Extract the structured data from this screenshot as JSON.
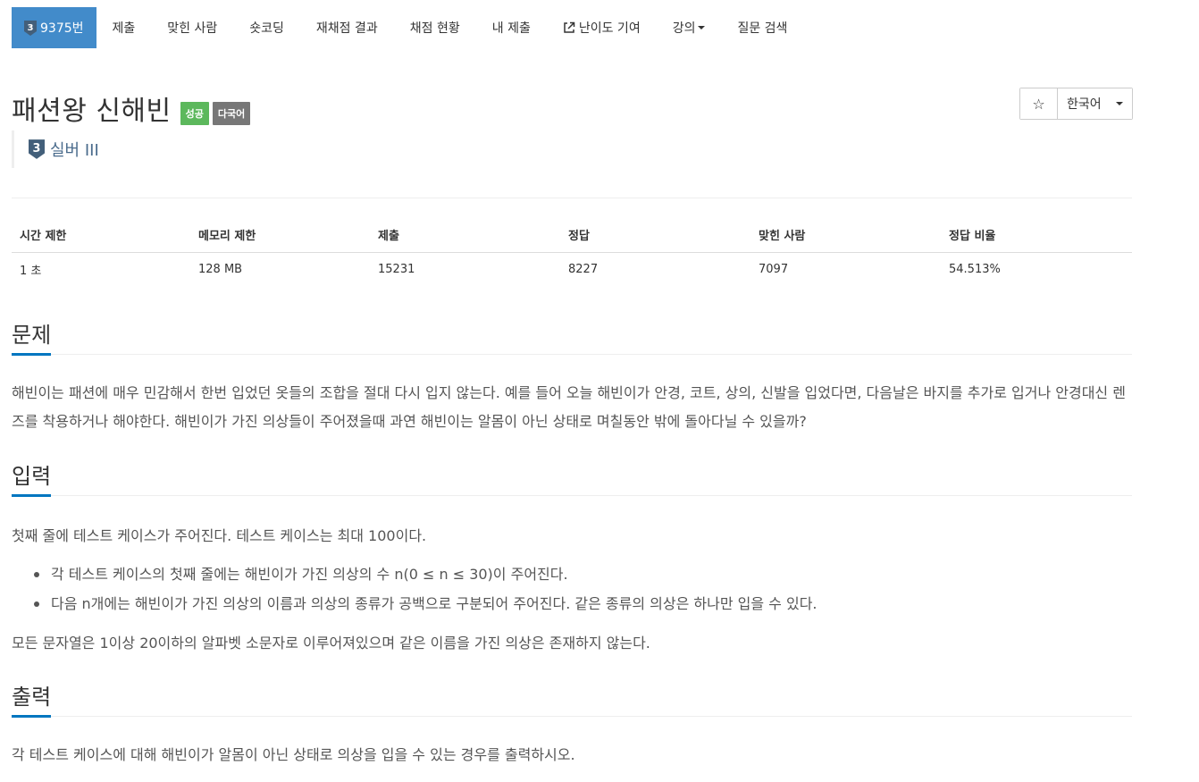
{
  "nav": {
    "problem_id": "9375번",
    "tier_badge_num": "3",
    "items": [
      "제출",
      "맞힌 사람",
      "숏코딩",
      "재채점 결과",
      "채점 현황",
      "내 제출"
    ],
    "contribute": "난이도 기여",
    "lecture": "강의",
    "qna": "질문 검색"
  },
  "title": {
    "text": "패션왕 신해빈",
    "label_success": "성공",
    "label_multilang": "다국어"
  },
  "actions": {
    "star": "☆",
    "language": "한국어"
  },
  "tier": {
    "num": "3",
    "text": "실버 III"
  },
  "info_table": {
    "headers": [
      "시간 제한",
      "메모리 제한",
      "제출",
      "정답",
      "맞힌 사람",
      "정답 비율"
    ],
    "values": [
      "1 초",
      "128 MB",
      "15231",
      "8227",
      "7097",
      "54.513%"
    ]
  },
  "sections": {
    "problem": {
      "heading": "문제",
      "body": "해빈이는 패션에 매우 민감해서 한번 입었던 옷들의 조합을 절대 다시 입지 않는다. 예를 들어 오늘 해빈이가 안경, 코트, 상의, 신발을 입었다면, 다음날은 바지를 추가로 입거나 안경대신 렌즈를 착용하거나 해야한다. 해빈이가 가진 의상들이 주어졌을때 과연 해빈이는 알몸이 아닌 상태로 며칠동안 밖에 돌아다닐 수 있을까?"
    },
    "input": {
      "heading": "입력",
      "intro": "첫째 줄에 테스트 케이스가 주어진다. 테스트 케이스는 최대 100이다.",
      "bullets": [
        "각 테스트 케이스의 첫째 줄에는 해빈이가 가진 의상의 수 n(0 ≤ n ≤ 30)이 주어진다.",
        "다음 n개에는 해빈이가 가진 의상의 이름과 의상의 종류가 공백으로 구분되어 주어진다. 같은 종류의 의상은 하나만 입을 수 있다."
      ],
      "outro": "모든 문자열은 1이상 20이하의 알파벳 소문자로 이루어져있으며 같은 이름을 가진 의상은 존재하지 않는다."
    },
    "output": {
      "heading": "출력",
      "body": "각 테스트 케이스에 대해 해빈이가 알몸이 아닌 상태로 의상을 입을 수 있는 경우를 출력하시오."
    }
  },
  "colors": {
    "accent": "#428bca",
    "success": "#5cb85c",
    "label_gray": "#777777",
    "tier_silver": "#435f7a",
    "section_underline": "#0076c0"
  }
}
